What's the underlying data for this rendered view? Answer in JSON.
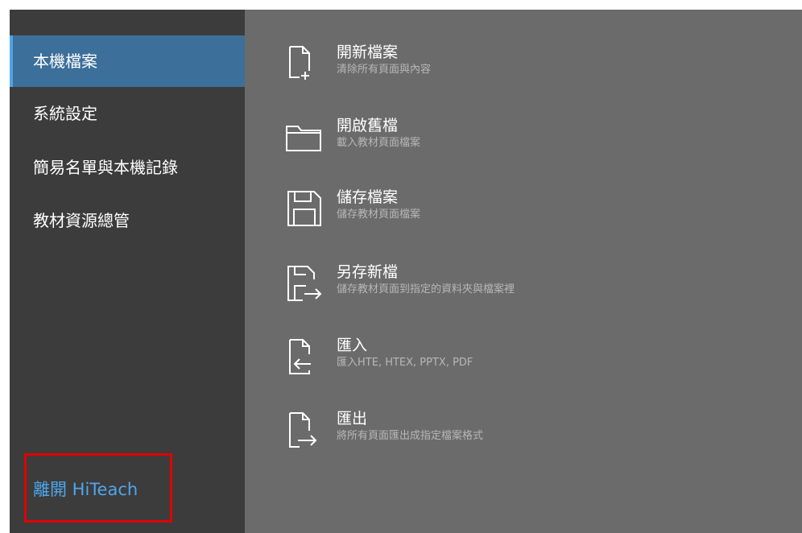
{
  "sidebar": {
    "items": [
      {
        "label": "本機檔案",
        "active": true
      },
      {
        "label": "系統設定",
        "active": false
      },
      {
        "label": "簡易名單與本機記錄",
        "active": false
      },
      {
        "label": "教材資源總管",
        "active": false
      }
    ],
    "exit_label": "離開 HiTeach"
  },
  "actions": [
    {
      "title": "開新檔案",
      "desc": "清除所有頁面與內容",
      "icon": "new-file-icon"
    },
    {
      "title": "開啟舊檔",
      "desc": "載入教材頁面檔案",
      "icon": "folder-icon"
    },
    {
      "title": "儲存檔案",
      "desc": "儲存教材頁面檔案",
      "icon": "save-icon"
    },
    {
      "title": "另存新檔",
      "desc": "儲存教材頁面到指定的資料夾與檔案裡",
      "icon": "save-as-icon"
    },
    {
      "title": "匯入",
      "desc": "匯入HTE, HTEX, PPTX, PDF",
      "icon": "import-icon"
    },
    {
      "title": "匯出",
      "desc": "將所有頁面匯出成指定檔案格式",
      "icon": "export-icon"
    }
  ],
  "colors": {
    "sidebar_bg": "#3c3c3c",
    "main_bg": "#6b6b6b",
    "active_bg": "#3c6f99",
    "accent": "#4fa6ec",
    "highlight_border": "#e00000"
  }
}
